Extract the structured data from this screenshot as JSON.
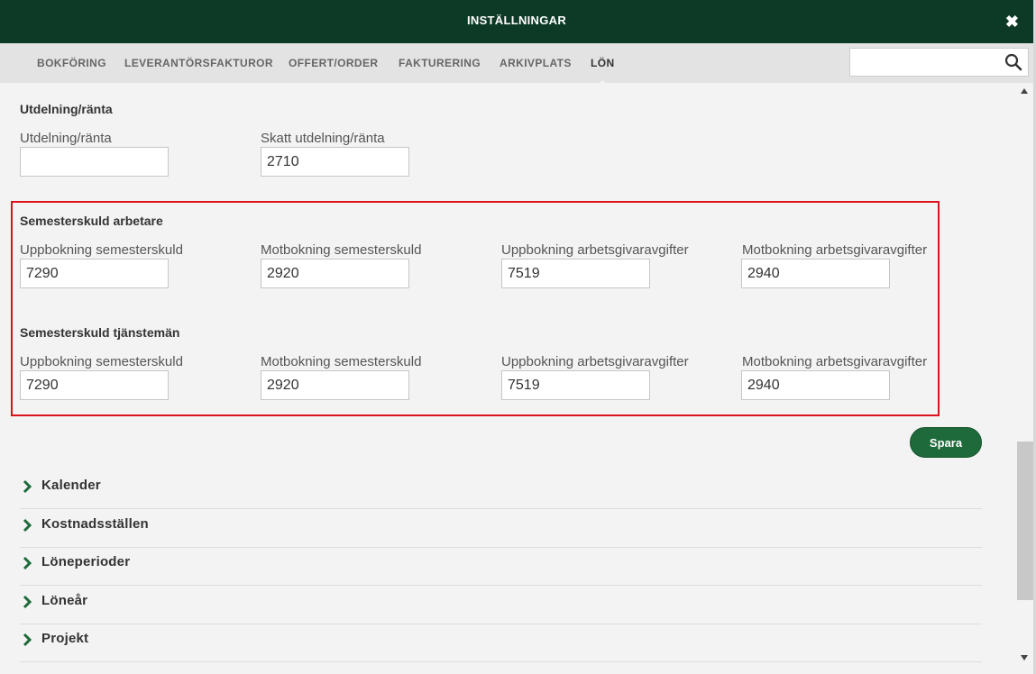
{
  "window": {
    "title": "INSTÄLLNINGAR",
    "close_glyph": "✖"
  },
  "tabs": [
    {
      "label": "BOKFÖRING"
    },
    {
      "label": "LEVERANTÖRSFAKTUROR"
    },
    {
      "label": "OFFERT/ORDER"
    },
    {
      "label": "FAKTURERING"
    },
    {
      "label": "ARKIVPLATS"
    },
    {
      "label": "LÖN",
      "active": true
    }
  ],
  "search": {
    "value": "",
    "placeholder": "",
    "icon": "search-icon"
  },
  "dividend": {
    "title": "Utdelning/ränta",
    "fields": [
      {
        "label": "Utdelning/ränta",
        "value": ""
      },
      {
        "label": "Skatt utdelning/ränta",
        "value": "2710"
      }
    ]
  },
  "holiday_workers": {
    "title": "Semesterskuld arbetare",
    "fields": [
      {
        "label": "Uppbokning semesterskuld",
        "value": "7290"
      },
      {
        "label": "Motbokning semesterskuld",
        "value": "2920"
      },
      {
        "label": "Uppbokning arbetsgivaravgifter",
        "value": "7519"
      },
      {
        "label": "Motbokning arbetsgivaravgifter",
        "value": "2940"
      }
    ]
  },
  "holiday_officials": {
    "title": "Semesterskuld tjänstemän",
    "fields": [
      {
        "label": "Uppbokning semesterskuld",
        "value": "7290"
      },
      {
        "label": "Motbokning semesterskuld",
        "value": "2920"
      },
      {
        "label": "Uppbokning arbetsgivaravgifter",
        "value": "7519"
      },
      {
        "label": "Motbokning arbetsgivaravgifter",
        "value": "2940"
      }
    ]
  },
  "save_button": {
    "label": "Spara"
  },
  "accordion": [
    {
      "label": "Kalender"
    },
    {
      "label": "Kostnadsställen"
    },
    {
      "label": "Löneperioder"
    },
    {
      "label": "Löneår"
    },
    {
      "label": "Projekt"
    }
  ],
  "colors": {
    "header_bg": "#0d3a26",
    "accent": "#1e6a3a",
    "highlight_border": "#d9121b"
  }
}
